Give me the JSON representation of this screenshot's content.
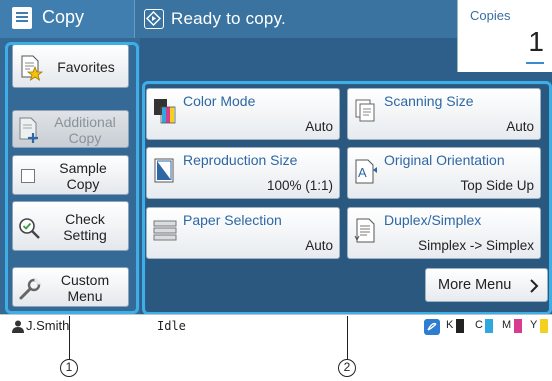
{
  "header": {
    "app_title": "Copy",
    "status_message": "Ready to copy.",
    "copies_label": "Copies",
    "copies_value": "1"
  },
  "sidebar": {
    "favorites": "Favorites",
    "additional_copy": "Additional\nCopy",
    "sample_copy": "Sample\nCopy",
    "check_setting": "Check\nSetting",
    "custom_menu": "Custom\nMenu"
  },
  "settings": {
    "color_mode": {
      "title": "Color Mode",
      "value": "Auto"
    },
    "scanning_size": {
      "title": "Scanning Size",
      "value": "Auto"
    },
    "reproduction_size": {
      "title": "Reproduction Size",
      "value": "100% (1:1)"
    },
    "original_orientation": {
      "title": "Original Orientation",
      "value": "Top Side Up"
    },
    "paper_selection": {
      "title": "Paper Selection",
      "value": "Auto"
    },
    "duplex_simplex": {
      "title": "Duplex/Simplex",
      "value": "Simplex -> Simplex"
    }
  },
  "more_menu": "More Menu",
  "footer": {
    "user": "J.Smith",
    "status": "Idle",
    "inks": [
      {
        "label": "K",
        "color": "#222222"
      },
      {
        "label": "C",
        "color": "#2fa8e0"
      },
      {
        "label": "M",
        "color": "#d63c8f"
      },
      {
        "label": "Y",
        "color": "#f2d21c"
      }
    ]
  },
  "callouts": {
    "sidebar_number": "1",
    "panel_number": "2"
  },
  "colors": {
    "screen_bg": "#2e5f8a",
    "accent": "#3eaee6",
    "title_text": "#2e67a4"
  }
}
